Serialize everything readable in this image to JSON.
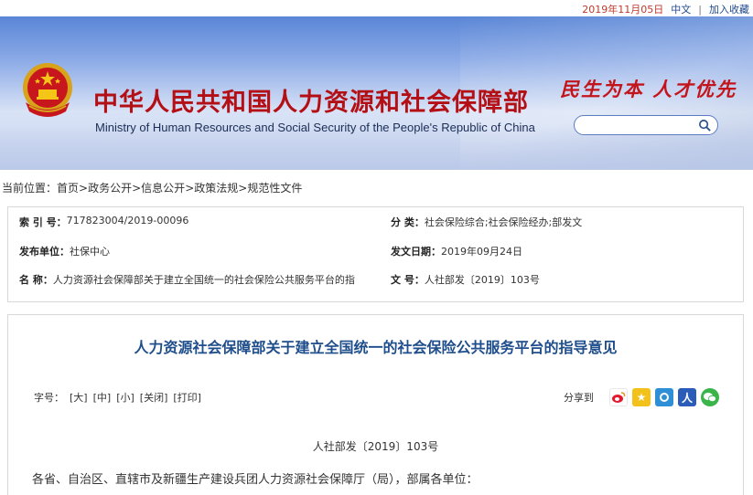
{
  "topbar": {
    "date": "2019年11月05日",
    "language": "中文",
    "separator": "|",
    "favorite": "加入收藏"
  },
  "header": {
    "title": "中华人民共和国人力资源和社会保障部",
    "subtitle": "Ministry of Human Resources and Social Security of the People's Republic of China",
    "slogan": "民生为本 人才优先",
    "search_placeholder": "",
    "colors": {
      "title": "#b40f14",
      "slogan": "#c4141b",
      "banner": "#5a86d6"
    }
  },
  "breadcrumb": {
    "prefix": "当前位置：",
    "items": [
      "首页",
      "政务公开",
      "信息公开",
      "政策法规",
      "规范性文件"
    ],
    "separator": ">"
  },
  "meta": {
    "index_label": "索 引 号：",
    "index_value": "717823004/2019-00096",
    "category_label": "分      类：",
    "category_value": "社会保险综合;社会保险经办;部发文",
    "publisher_label": "发布单位：",
    "publisher_value": "社保中心",
    "date_label": "发文日期：",
    "date_value": "2019年09月24日",
    "name_label": "名      称：",
    "name_value": "人力资源社会保障部关于建立全国统一的社会保险公共服务平台的指",
    "docno_label": "文      号：",
    "docno_value": "人社部发〔2019〕103号"
  },
  "article": {
    "title": "人力资源社会保障部关于建立全国统一的社会保险公共服务平台的指导意见",
    "fontsize_label": "字号：",
    "fontsize_options": [
      "[大]",
      "[中]",
      "[小]",
      "[关闭]",
      "[打印]"
    ],
    "share_label": "分享到",
    "share_icons": [
      "weibo-icon",
      "favorite-star-icon",
      "qq-icon",
      "renren-icon",
      "wechat-icon"
    ],
    "doc_number": "人社部发〔2019〕103号",
    "addressee": "各省、自治区、直辖市及新疆生产建设兵团人力资源社会保障厅（局），部属各单位："
  }
}
